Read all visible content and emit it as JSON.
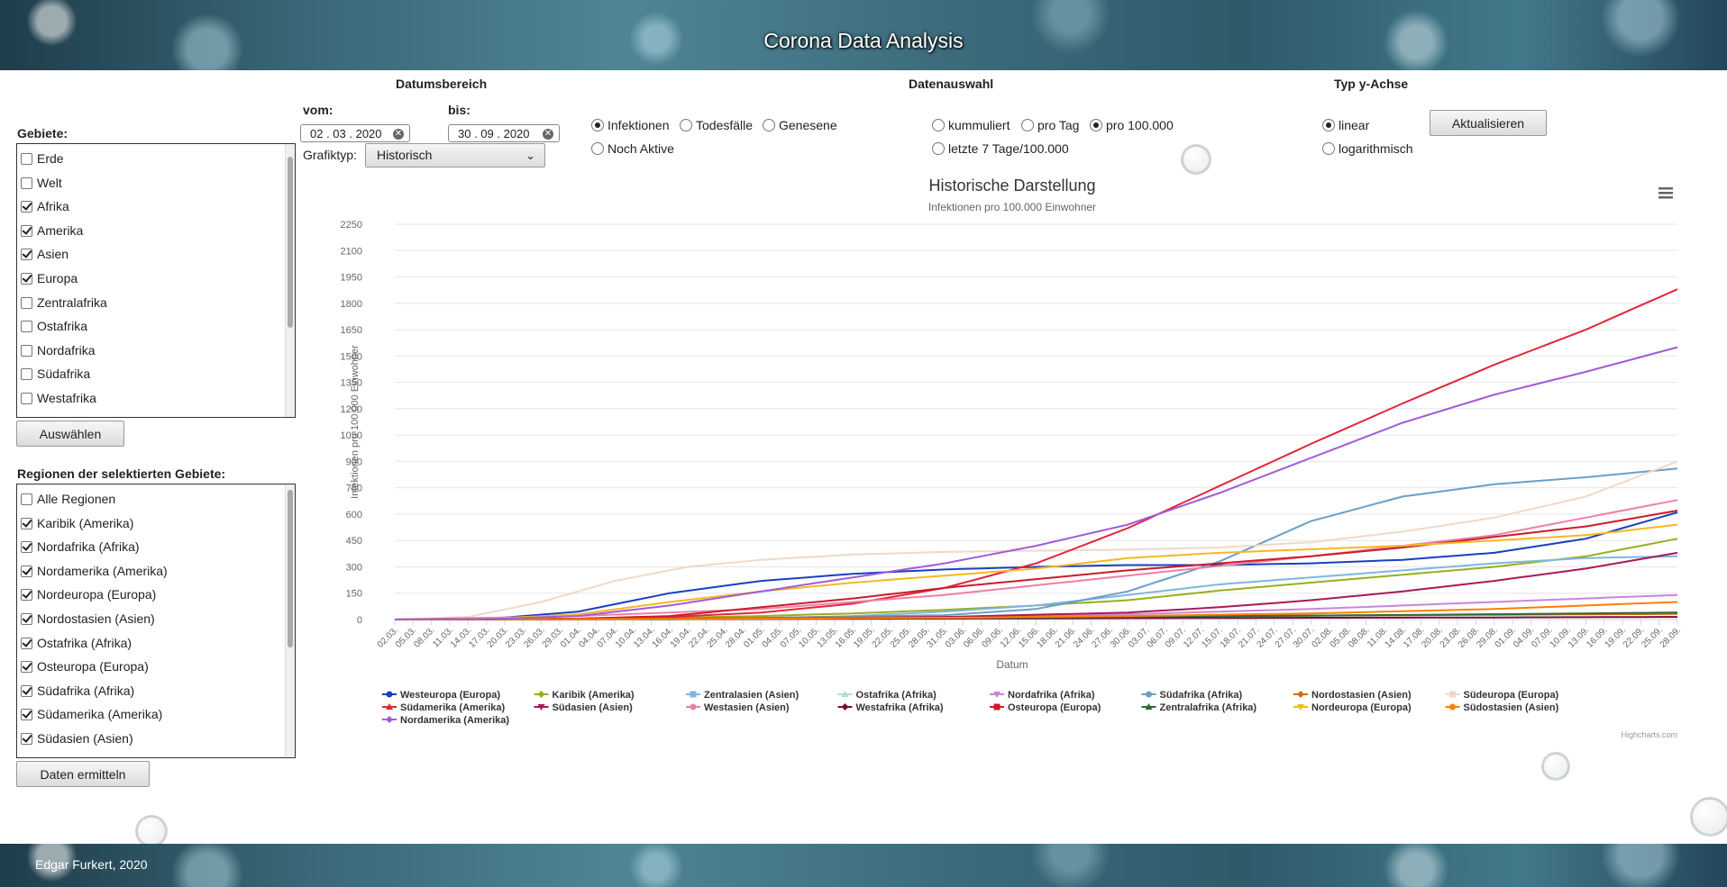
{
  "app": {
    "title": "Corona Data Analysis",
    "footer": "Edgar Furkert, 2020"
  },
  "date_range": {
    "title": "Datumsbereich",
    "from_label": "vom:",
    "to_label": "bis:",
    "from": "02 . 03 . 2020",
    "to": "30 . 09 . 2020"
  },
  "charttype": {
    "label": "Grafiktyp:",
    "value": "Historisch"
  },
  "metric": {
    "options": [
      "Infektionen",
      "Todesfälle",
      "Genesene",
      "Noch Aktive"
    ],
    "selected": "Infektionen"
  },
  "data_selection": {
    "title": "Datenauswahl",
    "options": [
      "kummuliert",
      "pro Tag",
      "pro 100.000",
      "letzte 7 Tage/100.000"
    ],
    "selected": "pro 100.000"
  },
  "yaxis_type": {
    "title": "Typ y-Achse",
    "options": [
      "linear",
      "logarithmisch"
    ],
    "selected": "linear"
  },
  "buttons": {
    "update": "Aktualisieren",
    "select": "Auswählen",
    "fetch": "Daten ermitteln"
  },
  "areas": {
    "label": "Gebiete:",
    "items": [
      {
        "label": "Erde",
        "checked": false
      },
      {
        "label": "Welt",
        "checked": false
      },
      {
        "label": "Afrika",
        "checked": true
      },
      {
        "label": "Amerika",
        "checked": true
      },
      {
        "label": "Asien",
        "checked": true
      },
      {
        "label": "Europa",
        "checked": true
      },
      {
        "label": "Zentralafrika",
        "checked": false
      },
      {
        "label": "Ostafrika",
        "checked": false
      },
      {
        "label": "Nordafrika",
        "checked": false
      },
      {
        "label": "Südafrika",
        "checked": false
      },
      {
        "label": "Westafrika",
        "checked": false
      }
    ]
  },
  "regions": {
    "label": "Regionen der selektierten Gebiete:",
    "items": [
      {
        "label": "Alle Regionen",
        "checked": false
      },
      {
        "label": "Karibik (Amerika)",
        "checked": true
      },
      {
        "label": "Nordafrika (Afrika)",
        "checked": true
      },
      {
        "label": "Nordamerika (Amerika)",
        "checked": true
      },
      {
        "label": "Nordeuropa (Europa)",
        "checked": true
      },
      {
        "label": "Nordostasien (Asien)",
        "checked": true
      },
      {
        "label": "Ostafrika (Afrika)",
        "checked": true
      },
      {
        "label": "Osteuropa (Europa)",
        "checked": true
      },
      {
        "label": "Südafrika (Afrika)",
        "checked": true
      },
      {
        "label": "Südamerika (Amerika)",
        "checked": true
      },
      {
        "label": "Südasien (Asien)",
        "checked": true
      }
    ]
  },
  "chart_data": {
    "type": "line",
    "title": "Historische Darstellung",
    "subtitle": "Infektionen pro 100.000 Einwohner",
    "xlabel": "Datum",
    "ylabel": "Infektionen pro 100.000 Einwohner",
    "ylim": [
      0,
      2250
    ],
    "yticks": [
      0,
      150,
      300,
      450,
      600,
      750,
      900,
      1050,
      1200,
      1350,
      1500,
      1650,
      1800,
      1950,
      2100,
      2250
    ],
    "grid": true,
    "legend_position": "bottom",
    "credit": "Highcharts.com",
    "x": [
      "02.03.",
      "05.03.",
      "08.03.",
      "11.03.",
      "14.03.",
      "17.03.",
      "20.03.",
      "23.03.",
      "26.03.",
      "29.03.",
      "01.04.",
      "04.04.",
      "07.04.",
      "10.04.",
      "13.04.",
      "16.04.",
      "19.04.",
      "22.04.",
      "25.04.",
      "28.04.",
      "01.05.",
      "04.05.",
      "07.05.",
      "10.05.",
      "13.05.",
      "16.05.",
      "19.05.",
      "22.05.",
      "25.05.",
      "28.05.",
      "31.05.",
      "03.06.",
      "06.06.",
      "09.06.",
      "12.06.",
      "15.06.",
      "18.06.",
      "21.06.",
      "24.06.",
      "27.06.",
      "30.06.",
      "03.07.",
      "06.07.",
      "09.07.",
      "12.07.",
      "15.07.",
      "18.07.",
      "21.07.",
      "24.07.",
      "27.07.",
      "30.07.",
      "02.08.",
      "05.08.",
      "08.08.",
      "11.08.",
      "14.08.",
      "17.08.",
      "20.08.",
      "23.08.",
      "26.08.",
      "29.08.",
      "01.09.",
      "04.09.",
      "07.09.",
      "10.09.",
      "13.09.",
      "16.09.",
      "19.09.",
      "22.09.",
      "25.09.",
      "28.09."
    ],
    "series": [
      {
        "name": "Westeuropa (Europa)",
        "color": "#1a3fbf",
        "marker": "circle",
        "anchors": [
          [
            0,
            0
          ],
          [
            5,
            3
          ],
          [
            10,
            45
          ],
          [
            15,
            150
          ],
          [
            20,
            220
          ],
          [
            25,
            260
          ],
          [
            30,
            285
          ],
          [
            35,
            300
          ],
          [
            40,
            310
          ],
          [
            45,
            310
          ],
          [
            50,
            320
          ],
          [
            55,
            340
          ],
          [
            60,
            380
          ],
          [
            65,
            460
          ],
          [
            70,
            610
          ]
        ]
      },
      {
        "name": "Karibik (Amerika)",
        "color": "#9aae1d",
        "marker": "diamond",
        "anchors": [
          [
            0,
            0
          ],
          [
            10,
            5
          ],
          [
            15,
            10
          ],
          [
            20,
            20
          ],
          [
            25,
            35
          ],
          [
            30,
            55
          ],
          [
            35,
            80
          ],
          [
            40,
            110
          ],
          [
            45,
            165
          ],
          [
            50,
            210
          ],
          [
            55,
            255
          ],
          [
            60,
            300
          ],
          [
            65,
            360
          ],
          [
            70,
            460
          ]
        ]
      },
      {
        "name": "Zentralasien (Asien)",
        "color": "#7fb6e0",
        "marker": "square",
        "anchors": [
          [
            0,
            0
          ],
          [
            10,
            2
          ],
          [
            20,
            8
          ],
          [
            25,
            20
          ],
          [
            30,
            45
          ],
          [
            35,
            80
          ],
          [
            40,
            140
          ],
          [
            45,
            200
          ],
          [
            50,
            240
          ],
          [
            55,
            280
          ],
          [
            60,
            320
          ],
          [
            65,
            350
          ],
          [
            70,
            360
          ]
        ]
      },
      {
        "name": "Ostafrika (Afrika)",
        "color": "#a8dfd9",
        "marker": "triangle",
        "anchors": [
          [
            0,
            0
          ],
          [
            20,
            2
          ],
          [
            30,
            5
          ],
          [
            40,
            10
          ],
          [
            50,
            20
          ],
          [
            60,
            30
          ],
          [
            70,
            40
          ]
        ]
      },
      {
        "name": "Nordafrika (Afrika)",
        "color": "#c986d8",
        "marker": "triangle-down",
        "anchors": [
          [
            0,
            0
          ],
          [
            20,
            5
          ],
          [
            30,
            12
          ],
          [
            40,
            30
          ],
          [
            50,
            60
          ],
          [
            60,
            100
          ],
          [
            70,
            140
          ]
        ]
      },
      {
        "name": "Südafrika (Afrika)",
        "color": "#6a9fc8",
        "marker": "circle",
        "anchors": [
          [
            0,
            0
          ],
          [
            20,
            10
          ],
          [
            30,
            25
          ],
          [
            35,
            60
          ],
          [
            40,
            160
          ],
          [
            45,
            330
          ],
          [
            50,
            560
          ],
          [
            55,
            700
          ],
          [
            60,
            770
          ],
          [
            65,
            810
          ],
          [
            70,
            860
          ]
        ]
      },
      {
        "name": "Nordostasien (Asien)",
        "color": "#d76a10",
        "marker": "diamond",
        "anchors": [
          [
            0,
            0
          ],
          [
            20,
            10
          ],
          [
            40,
            18
          ],
          [
            60,
            27
          ],
          [
            70,
            32
          ]
        ]
      },
      {
        "name": "Südeuropa (Europa)",
        "color": "#f0d9c8",
        "marker": "square",
        "anchors": [
          [
            0,
            0
          ],
          [
            4,
            15
          ],
          [
            8,
            100
          ],
          [
            12,
            220
          ],
          [
            16,
            300
          ],
          [
            20,
            340
          ],
          [
            25,
            370
          ],
          [
            30,
            385
          ],
          [
            35,
            392
          ],
          [
            40,
            398
          ],
          [
            45,
            410
          ],
          [
            50,
            440
          ],
          [
            55,
            500
          ],
          [
            60,
            580
          ],
          [
            65,
            700
          ],
          [
            70,
            900
          ]
        ]
      },
      {
        "name": "Südamerika (Amerika)",
        "color": "#e3263a",
        "marker": "triangle",
        "anchors": [
          [
            0,
            0
          ],
          [
            10,
            5
          ],
          [
            15,
            15
          ],
          [
            20,
            40
          ],
          [
            25,
            90
          ],
          [
            30,
            180
          ],
          [
            35,
            320
          ],
          [
            40,
            520
          ],
          [
            45,
            760
          ],
          [
            50,
            1000
          ],
          [
            55,
            1230
          ],
          [
            60,
            1450
          ],
          [
            65,
            1650
          ],
          [
            70,
            1880
          ]
        ]
      },
      {
        "name": "Südasien (Asien)",
        "color": "#a81a58",
        "marker": "triangle-down",
        "anchors": [
          [
            0,
            0
          ],
          [
            20,
            5
          ],
          [
            30,
            15
          ],
          [
            40,
            40
          ],
          [
            45,
            70
          ],
          [
            50,
            110
          ],
          [
            55,
            160
          ],
          [
            60,
            220
          ],
          [
            65,
            290
          ],
          [
            70,
            380
          ]
        ]
      },
      {
        "name": "Westasien (Asien)",
        "color": "#ee80a5",
        "marker": "circle",
        "anchors": [
          [
            0,
            0
          ],
          [
            10,
            20
          ],
          [
            20,
            60
          ],
          [
            30,
            140
          ],
          [
            40,
            250
          ],
          [
            50,
            360
          ],
          [
            60,
            480
          ],
          [
            70,
            680
          ]
        ]
      },
      {
        "name": "Westafrika (Afrika)",
        "color": "#7a0f35",
        "marker": "diamond",
        "anchors": [
          [
            0,
            0
          ],
          [
            20,
            3
          ],
          [
            40,
            8
          ],
          [
            60,
            12
          ],
          [
            70,
            15
          ]
        ]
      },
      {
        "name": "Osteuropa (Europa)",
        "color": "#cc1b2b",
        "marker": "square",
        "anchors": [
          [
            0,
            0
          ],
          [
            10,
            5
          ],
          [
            15,
            20
          ],
          [
            20,
            70
          ],
          [
            25,
            120
          ],
          [
            30,
            180
          ],
          [
            35,
            230
          ],
          [
            40,
            280
          ],
          [
            45,
            320
          ],
          [
            50,
            360
          ],
          [
            55,
            410
          ],
          [
            60,
            470
          ],
          [
            65,
            530
          ],
          [
            70,
            620
          ]
        ]
      },
      {
        "name": "Zentralafrika (Afrika)",
        "color": "#2d6b3a",
        "marker": "triangle",
        "anchors": [
          [
            0,
            0
          ],
          [
            20,
            5
          ],
          [
            40,
            15
          ],
          [
            60,
            30
          ],
          [
            70,
            40
          ]
        ]
      },
      {
        "name": "Nordeuropa (Europa)",
        "color": "#f4b820",
        "marker": "triangle-down",
        "anchors": [
          [
            0,
            0
          ],
          [
            5,
            2
          ],
          [
            10,
            30
          ],
          [
            15,
            100
          ],
          [
            20,
            160
          ],
          [
            25,
            210
          ],
          [
            30,
            250
          ],
          [
            35,
            290
          ],
          [
            40,
            350
          ],
          [
            45,
            380
          ],
          [
            50,
            400
          ],
          [
            55,
            420
          ],
          [
            60,
            450
          ],
          [
            65,
            480
          ],
          [
            70,
            540
          ]
        ]
      },
      {
        "name": "Südostasien (Asien)",
        "color": "#ff7f00",
        "marker": "circle",
        "anchors": [
          [
            0,
            0
          ],
          [
            20,
            5
          ],
          [
            30,
            10
          ],
          [
            40,
            20
          ],
          [
            50,
            35
          ],
          [
            60,
            60
          ],
          [
            70,
            100
          ]
        ]
      },
      {
        "name": "Nordamerika (Amerika)",
        "color": "#a25ad8",
        "marker": "diamond",
        "anchors": [
          [
            0,
            0
          ],
          [
            5,
            2
          ],
          [
            10,
            20
          ],
          [
            15,
            80
          ],
          [
            20,
            160
          ],
          [
            25,
            240
          ],
          [
            30,
            320
          ],
          [
            35,
            420
          ],
          [
            40,
            540
          ],
          [
            45,
            720
          ],
          [
            50,
            920
          ],
          [
            55,
            1120
          ],
          [
            60,
            1280
          ],
          [
            65,
            1410
          ],
          [
            70,
            1550
          ]
        ]
      }
    ]
  }
}
